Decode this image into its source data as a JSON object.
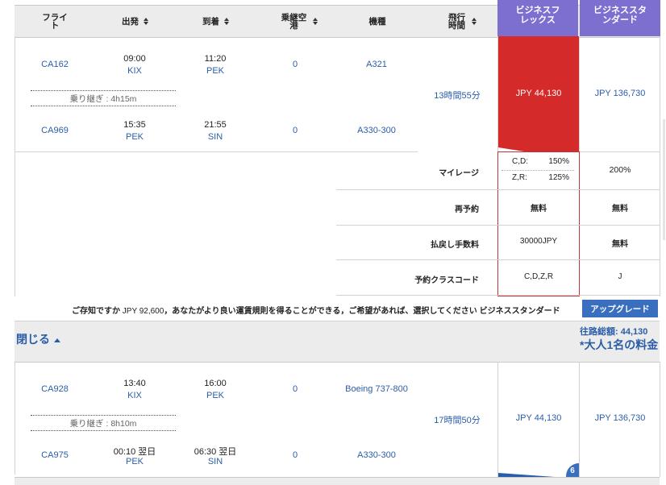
{
  "header": {
    "flight": "フライト",
    "depart": "出発",
    "arrive": "到着",
    "transit": "乗継空港",
    "aircraft": "機種",
    "duration": "飛行時間",
    "fare1": "ビジネスフレックス",
    "fare2": "ビジネススタンダード"
  },
  "outbound": {
    "leg1": {
      "flight": "CA162",
      "dep_time": "09:00",
      "dep_code": "KIX",
      "arr_time": "11:20",
      "arr_code": "PEK",
      "transit": "0",
      "aircraft": "A321"
    },
    "layover_label": "乗り継ぎ",
    "layover_time": "4h15m",
    "leg2": {
      "flight": "CA969",
      "dep_time": "15:35",
      "dep_code": "PEK",
      "arr_time": "21:55",
      "arr_code": "SIN",
      "transit": "0",
      "aircraft": "A330-300"
    },
    "duration": "13時間55分",
    "fare1": "JPY 44,130",
    "fare2": "JPY 136,730"
  },
  "rules": {
    "mileage_label": "マイレージ",
    "mileage_fare1": [
      {
        "code": "C,D:",
        "pct": "150%"
      },
      {
        "code": "Z,R:",
        "pct": "125%"
      }
    ],
    "mileage_fare2": "200%",
    "rebook_label": "再予約",
    "rebook_fare1": "無料",
    "rebook_fare2": "無料",
    "refund_label": "払戻し手数料",
    "refund_fare1": "30000JPY",
    "refund_fare2": "無料",
    "class_label": "予約クラスコード",
    "class_fare1": "C,D,Z,R",
    "class_fare2": "J"
  },
  "upgrade": {
    "message_a": "ご存知ですか",
    "message_amount": "JPY 92,600",
    "message_b": "，あなたがより良い運賃規則を得ることができる，ご希望があれば、選択してください",
    "message_fare": "ビジネススタンダード",
    "button": "アップグレード"
  },
  "summary": {
    "close": "閉じる",
    "total_label": "往路総額: 44,130",
    "per_adult": "*大人1名の料金"
  },
  "inbound": {
    "leg1": {
      "flight": "CA928",
      "dep_time": "13:40",
      "dep_code": "KIX",
      "arr_time": "16:00",
      "arr_code": "PEK",
      "transit": "0",
      "aircraft": "Boeing 737-800"
    },
    "layover_label": "乗り継ぎ",
    "layover_time": "8h10m",
    "leg2": {
      "flight": "CA975",
      "dep_time": "00:10 翌日",
      "dep_code": "PEK",
      "arr_time": "06:30 翌日",
      "arr_code": "SIN",
      "transit": "0",
      "aircraft": "A330-300"
    },
    "duration": "17時間50分",
    "fare1": "JPY 44,130",
    "fare2": "JPY 136,730",
    "seats_badge": "6"
  },
  "colors": {
    "header_fare": "#7d6fd0",
    "selected": "#d42a2a",
    "link": "#2a5da8",
    "button": "#3a6fbf"
  }
}
